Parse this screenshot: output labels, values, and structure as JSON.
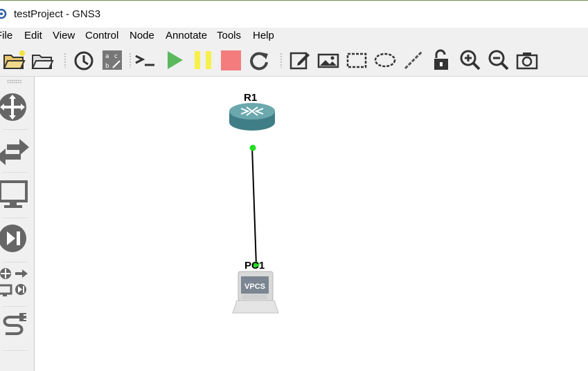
{
  "window": {
    "title": "testProject - GNS3"
  },
  "menu": {
    "file": "File",
    "edit": "Edit",
    "view": "View",
    "control": "Control",
    "node": "Node",
    "annotate": "Annotate",
    "tools": "Tools",
    "help": "Help"
  },
  "toolbar_icons": [
    "new-project-icon",
    "open-project-icon",
    "snapshot-clock-icon",
    "show-interface-labels-icon",
    "console-all-icon",
    "start-all-icon",
    "suspend-all-icon",
    "stop-all-icon",
    "reload-all-icon",
    "add-note-icon",
    "insert-picture-icon",
    "draw-rectangle-icon",
    "draw-ellipse-icon",
    "draw-line-icon",
    "lock-unlock-icon",
    "zoom-in-icon",
    "zoom-out-icon",
    "screenshot-icon"
  ],
  "dock_categories": [
    "routers",
    "switches",
    "end-devices",
    "security-devices",
    "all-devices",
    "add-link"
  ],
  "topology": {
    "nodes": [
      {
        "name": "R1",
        "type": "router"
      },
      {
        "name": "PC1",
        "type": "vpcs",
        "screen_text": "VPCS"
      }
    ],
    "links": [
      {
        "from": "R1",
        "to": "PC1",
        "status": "up",
        "status_color": "#22dd22"
      }
    ]
  },
  "colors": {
    "start_green": "#5cb85c",
    "suspend_yellow": "#f7f04a",
    "stop_red": "#f47c7c",
    "router_teal": "#4f8f96",
    "link_status_green": "#22dd22"
  }
}
